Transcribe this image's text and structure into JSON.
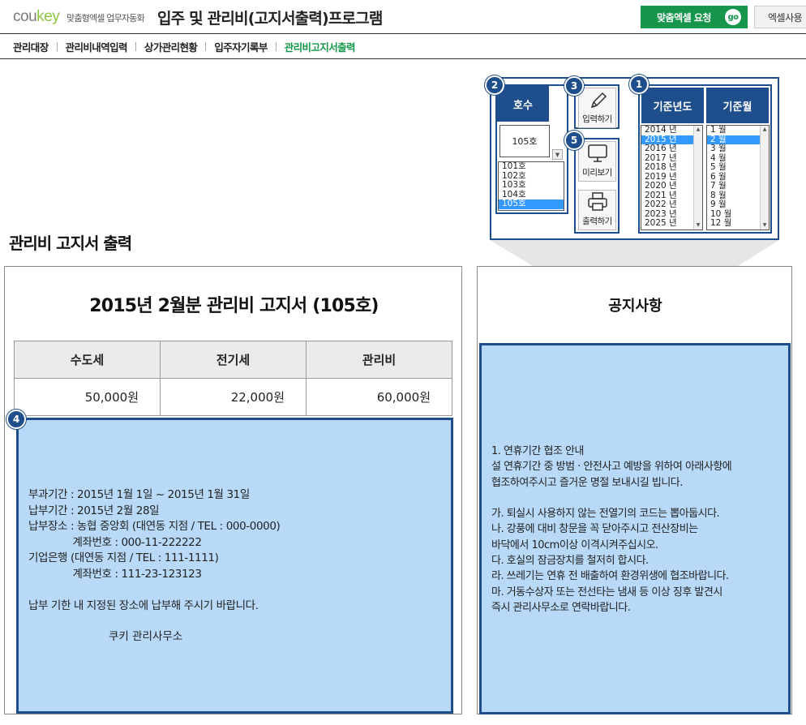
{
  "header": {
    "logo_main": "cou",
    "logo_accent": "key",
    "logo_tagline": "맞춤형엑셀 업무자동화",
    "title": "입주 및 관리비(고지서출력)프로그램",
    "request_button": "맞춤엑셀 요청",
    "go_label": "go",
    "excel_button": "엑셀사용"
  },
  "nav": {
    "items": [
      {
        "label": "관리대장",
        "active": false
      },
      {
        "label": "관리비내역입력",
        "active": false
      },
      {
        "label": "상가관리현황",
        "active": false
      },
      {
        "label": "입주자기록부",
        "active": false
      },
      {
        "label": "관리비고지서출력",
        "active": true
      }
    ]
  },
  "section_title": "관리비 고지서 출력",
  "controls": {
    "unit": {
      "badge": "2",
      "header": "호수",
      "selected": "105호",
      "options": [
        "101호",
        "102호",
        "103호",
        "104호",
        "105호"
      ],
      "selected_index": 4
    },
    "input": {
      "badge": "3",
      "label": "입력하기",
      "icon": "pencil-icon"
    },
    "output": {
      "badge": "5",
      "preview_label": "미리보기",
      "preview_icon": "monitor-icon",
      "print_label": "출력하기",
      "print_icon": "printer-icon"
    },
    "date": {
      "badge": "1",
      "year_header": "기준년도",
      "month_header": "기준월",
      "years": [
        "2014 년",
        "2015 년",
        "2016 년",
        "2017 년",
        "2018 년",
        "2019 년",
        "2020 년",
        "2021 년",
        "2022 년",
        "2023 년",
        "2025 년"
      ],
      "selected_year_index": 1,
      "months": [
        "1 월",
        "2 월",
        "3 월",
        "4 월",
        "5 월",
        "6 월",
        "7 월",
        "8 월",
        "9 월",
        "10 월",
        "12 월"
      ],
      "selected_month_index": 1
    }
  },
  "bill": {
    "title": "2015년 2월분 관리비 고지서 (105호)",
    "columns": [
      "수도세",
      "전기세",
      "관리비"
    ],
    "values": [
      "50,000원",
      "22,000원",
      "60,000원"
    ],
    "badge": "4",
    "details": "부과기간 : 2015년 1월 1일 ~ 2015년 1월 31일\n납부기간 : 2015년 2월 28일\n납부장소 : 농협 중앙회 (대연동 지점 / TEL : 000-0000)\n              계좌번호 : 000-11-222222\n기업은행 (대연동 지점 / TEL : 111-1111)\n              계좌번호 : 111-23-123123\n\n납부 기한 내 지정된 장소에 납부해 주시기 바랍니다.",
    "signature": "쿠키 관리사무소"
  },
  "notice": {
    "title": "공지사항",
    "text": "1. 연휴기간 협조 안내\n설 연휴기간 중 방범 · 안전사고 예방을 위하여 아래사항에\n협조하여주시고 즐거운 명절 보내시길 빕니다.\n\n가. 퇴실시 사용하지 않는 전열기의 코드는 뽑아둡시다.\n나. 강풍에 대비 창문을 꼭 닫아주시고 전산장비는\n바닥에서 10cm이상 이격시켜주십시오.\n다. 호실의 잠금장치를 철저히 합시다.\n라. 쓰레기는 연휴 전 배출하여 환경위생에 협조바랍니다.\n마. 거동수상자 또는 전선타는 냄새 등 이상 징후 발견시\n즉시 관리사무소로 연락바랍니다."
  },
  "colors": {
    "brand_green": "#16964a",
    "logo_green": "#8cc63f",
    "panel_blue": "#1f4e8c",
    "box_fill": "#b8d9f8",
    "selection": "#3399ff"
  }
}
